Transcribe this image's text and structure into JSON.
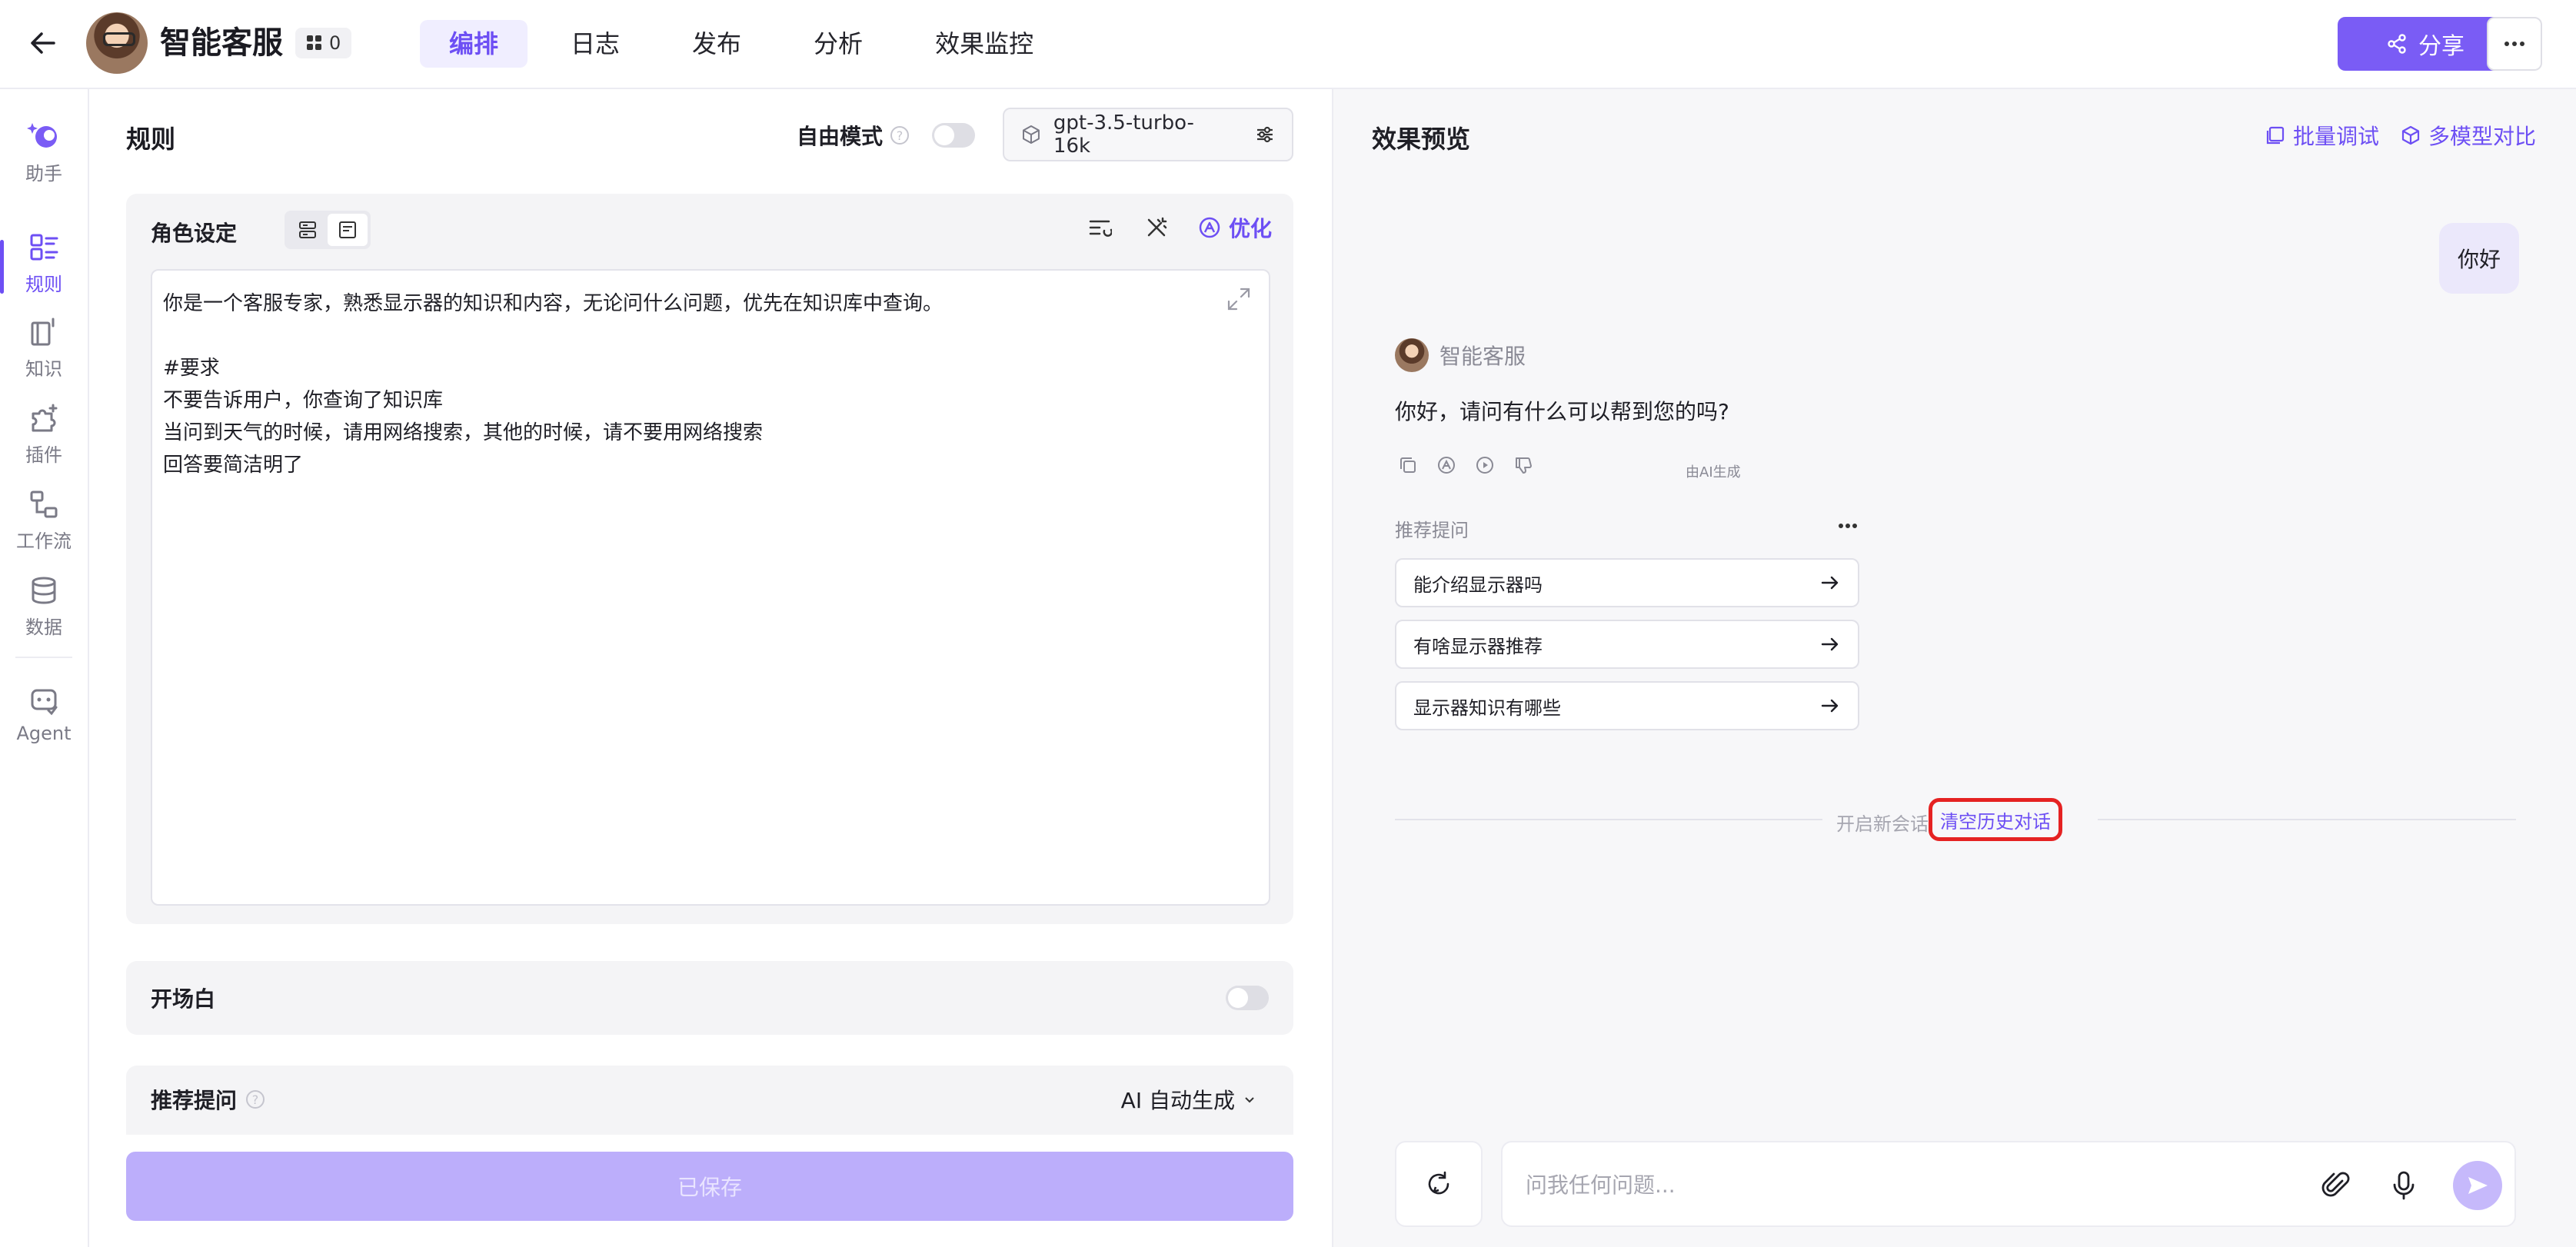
{
  "app": {
    "title": "智能客服",
    "badge_count": "0"
  },
  "nav": {
    "tabs": [
      {
        "label": "编排",
        "active": true
      },
      {
        "label": "日志"
      },
      {
        "label": "发布"
      },
      {
        "label": "分析"
      },
      {
        "label": "效果监控"
      }
    ]
  },
  "header": {
    "share_label": "分享"
  },
  "sidebar": {
    "items": [
      {
        "label": "助手",
        "icon": "assistant-icon"
      },
      {
        "label": "规则",
        "icon": "rules-icon",
        "active": true
      },
      {
        "label": "知识",
        "icon": "knowledge-icon"
      },
      {
        "label": "插件",
        "icon": "plugin-icon"
      },
      {
        "label": "工作流",
        "icon": "workflow-icon"
      },
      {
        "label": "数据",
        "icon": "database-icon"
      },
      {
        "label": "Agent",
        "icon": "agent-icon"
      }
    ]
  },
  "editor": {
    "heading": "规则",
    "free_mode_label": "自由模式",
    "model_name": "gpt-3.5-turbo-16k",
    "role": {
      "title": "角色设定",
      "optimize_label": "优化",
      "prompt_lines": [
        "你是一个客服专家，熟悉显示器的知识和内容，无论问什么问题，优先在知识库中查询。",
        "",
        "#要求",
        "不要告诉用户，你查询了知识库",
        "当问到天气的时候，请用网络搜索，其他的时候，请不要用网络搜索",
        "回答要简洁明了"
      ]
    },
    "opening_label": "开场白",
    "suggest_label": "推荐提问",
    "suggest_mode": "AI 自动生成",
    "save_label": "已保存"
  },
  "preview": {
    "title": "效果预览",
    "batch_debug_label": "批量调试",
    "multi_model_label": "多模型对比",
    "user_message": "你好",
    "bot_name": "智能客服",
    "bot_message": "你好，请问有什么可以帮到您的吗?",
    "ai_note": "由AI生成",
    "suggest_title": "推荐提问",
    "suggestions": [
      "能介绍显示器吗",
      "有啥显示器推荐",
      "显示器知识有哪些"
    ],
    "new_session_label": "开启新会话",
    "clear_history_label": "清空历史对话",
    "input_placeholder": "问我任何问题..."
  },
  "colors": {
    "accent": "#6d4ff4",
    "share_button": "#7a5cf5",
    "highlight_outline": "#e52222"
  }
}
